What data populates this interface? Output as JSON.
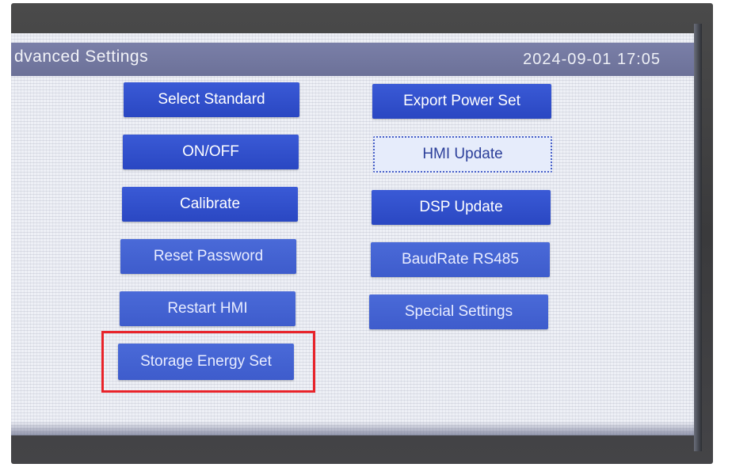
{
  "screen": {
    "title": "dvanced Settings",
    "datetime": "2024-09-01  17:05"
  },
  "buttons_left": [
    {
      "label": "Select Standard"
    },
    {
      "label": "ON/OFF"
    },
    {
      "label": "Calibrate"
    },
    {
      "label": "Reset Password"
    },
    {
      "label": "Restart HMI"
    },
    {
      "label": "Storage Energy Set"
    }
  ],
  "buttons_right": [
    {
      "label": "Export Power Set"
    },
    {
      "label": "HMI Update"
    },
    {
      "label": "DSP Update"
    },
    {
      "label": "BaudRate RS485"
    },
    {
      "label": "Special Settings"
    }
  ],
  "colors": {
    "button_blue": "#2f4fcf",
    "highlight_red": "#e8232a",
    "title_bar": "#7277a0"
  }
}
